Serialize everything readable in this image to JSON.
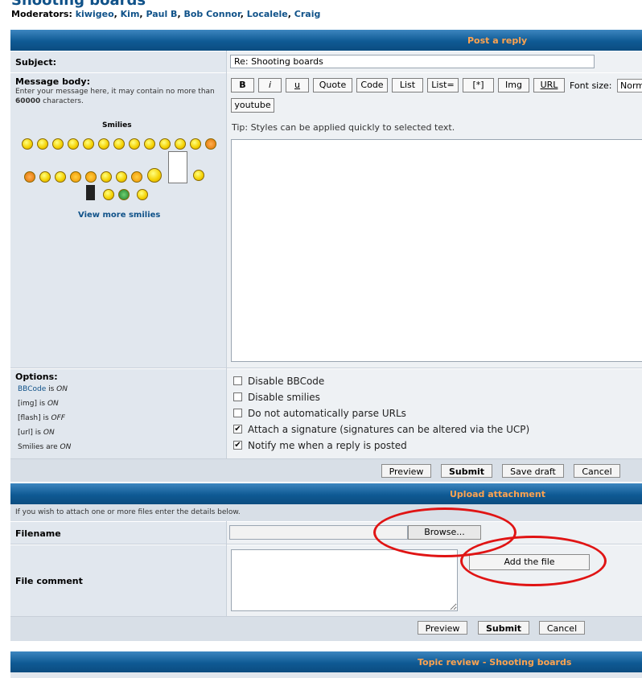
{
  "page": {
    "title": "Shooting boards",
    "moderators_label": "Moderators:",
    "moderators": [
      "kiwigeo",
      "Kim",
      "Paul B",
      "Bob Connor",
      "Localele",
      "Craig"
    ]
  },
  "post_reply": {
    "header": "Post a reply",
    "subject_label": "Subject:",
    "subject_value": "Re: Shooting boards",
    "message_label": "Message body:",
    "message_hint_pre": "Enter your message here, it may contain no more than ",
    "message_hint_limit": "60000",
    "message_hint_post": " characters.",
    "smilies_title": "Smilies",
    "view_more_smilies": "View more smilies",
    "toolbar": {
      "bold": "B",
      "italic": "i",
      "underline": "u",
      "quote": "Quote",
      "code": "Code",
      "list": "List",
      "list_eq": "List=",
      "list_item": "[*]",
      "img": "Img",
      "url": "URL",
      "font_size_label": "Font size:",
      "font_size_value": "Normal",
      "youtube": "youtube"
    },
    "tip": "Tip: Styles can be applied quickly to selected text.",
    "message_value": "",
    "options_label": "Options:",
    "options_status": {
      "bbcode_link": "BBCode",
      "bbcode_is": " is ",
      "bbcode_state": "ON",
      "img_tag": "[img]",
      "img_is": " is ",
      "img_state": "ON",
      "flash_tag": "[flash]",
      "flash_is": " is ",
      "flash_state": "OFF",
      "url_tag": "[url]",
      "url_is": " is ",
      "url_state": "ON",
      "smilies_tag": "Smilies",
      "smilies_are": " are ",
      "smilies_state": "ON"
    },
    "checkboxes": [
      {
        "label": "Disable BBCode",
        "checked": false
      },
      {
        "label": "Disable smilies",
        "checked": false
      },
      {
        "label": "Do not automatically parse URLs",
        "checked": false
      },
      {
        "label": "Attach a signature (signatures can be altered via the UCP)",
        "checked": true
      },
      {
        "label": "Notify me when a reply is posted",
        "checked": true
      }
    ],
    "buttons": {
      "preview": "Preview",
      "submit": "Submit",
      "save_draft": "Save draft",
      "cancel": "Cancel"
    }
  },
  "upload": {
    "header": "Upload attachment",
    "intro": "If you wish to attach one or more files enter the details below.",
    "filename_label": "Filename",
    "browse": "Browse...",
    "file_comment_label": "File comment",
    "add_file": "Add the file",
    "buttons": {
      "preview": "Preview",
      "submit": "Submit",
      "cancel": "Cancel"
    }
  },
  "topic_review": {
    "header": "Topic review - Shooting boards"
  },
  "colors": {
    "header_bar": "#0f5a94",
    "header_text": "#ffa34f",
    "link": "#105289",
    "annotation": "#e01414"
  }
}
